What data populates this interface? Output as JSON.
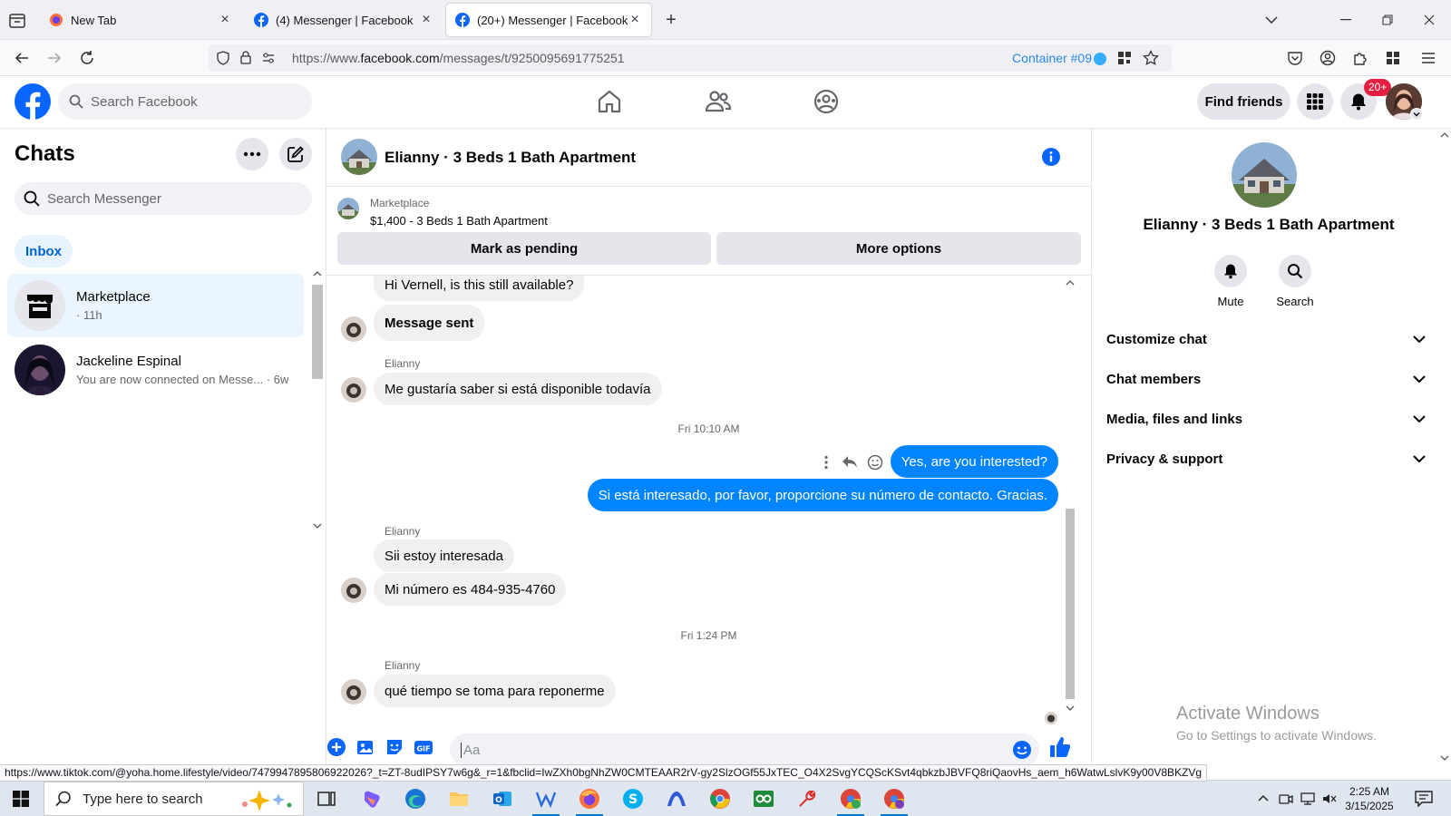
{
  "browser": {
    "tabs": [
      {
        "title": "New Tab",
        "active": false
      },
      {
        "title": "(4) Messenger | Facebook",
        "active": false
      },
      {
        "title": "(20+) Messenger | Facebook",
        "active": true
      }
    ],
    "url_prefix": "https://www.",
    "url_domain": "facebook.com",
    "url_path": "/messages/t/9250095691775251",
    "container_label": "Container #09",
    "status_url": "https://www.tiktok.com/@yoha.home.lifestyle/video/7479947895806922026?_t=ZT-8udIPSY7w6g&_r=1&fbclid=IwZXh0bgNhZW0CMTEAAR2rV-gy2SlzOGf55JxTEC_O4X2SvgYCQScKSvt4qbkzbJBVFQ8riQaovHs_aem_h6WatwLslvK9y00V8BKZVg"
  },
  "fb": {
    "search_placeholder": "Search Facebook",
    "find_friends": "Find friends",
    "notification_count": "20+"
  },
  "sidebar": {
    "title": "Chats",
    "search_placeholder": "Search Messenger",
    "inbox_label": "Inbox",
    "chats": [
      {
        "name": "Marketplace",
        "subtitle": "· 11h",
        "selected": true
      },
      {
        "name": "Jackeline Espinal",
        "subtitle": "You are now connected on Messe... · 6w",
        "selected": false
      }
    ]
  },
  "conversation": {
    "title": "Elianny · 3 Beds 1 Bath Apartment",
    "listing_source": "Marketplace",
    "listing_price": "$1,400 - 3 Beds 1 Bath Apartment",
    "mark_pending": "Mark as pending",
    "more_options": "More options",
    "messages": {
      "m1": "Hi Vernell, is this still available?",
      "m2": "Message sent",
      "sender1": "Elianny",
      "m3": "Me gustaría saber si está disponible todavía",
      "time1": "Fri 10:10 AM",
      "m4": "Yes, are you interested?",
      "m5": "Si está interesado, por favor, proporcione su número de contacto. Gracias.",
      "sender2": "Elianny",
      "m6": "Sii estoy interesada",
      "m7": "Mi número es 484-935-4760",
      "time2": "Fri 1:24 PM",
      "sender3": "Elianny",
      "m8": "qué tiempo se toma para reponerme"
    },
    "composer_placeholder": "Aa"
  },
  "info_panel": {
    "name": "Elianny · 3 Beds 1 Bath Apartment",
    "mute_label": "Mute",
    "search_label": "Search",
    "sections": [
      "Customize chat",
      "Chat members",
      "Media, files and links",
      "Privacy & support"
    ]
  },
  "watermark": {
    "line1": "Activate Windows",
    "line2": "Go to Settings to activate Windows."
  },
  "taskbar": {
    "search_placeholder": "Type here to search",
    "time": "2:25 AM",
    "date": "3/15/2025"
  },
  "colors": {
    "fb_blue": "#0866ff",
    "bubble_out": "#0084ff",
    "container_blue": "#2a8ae8"
  }
}
